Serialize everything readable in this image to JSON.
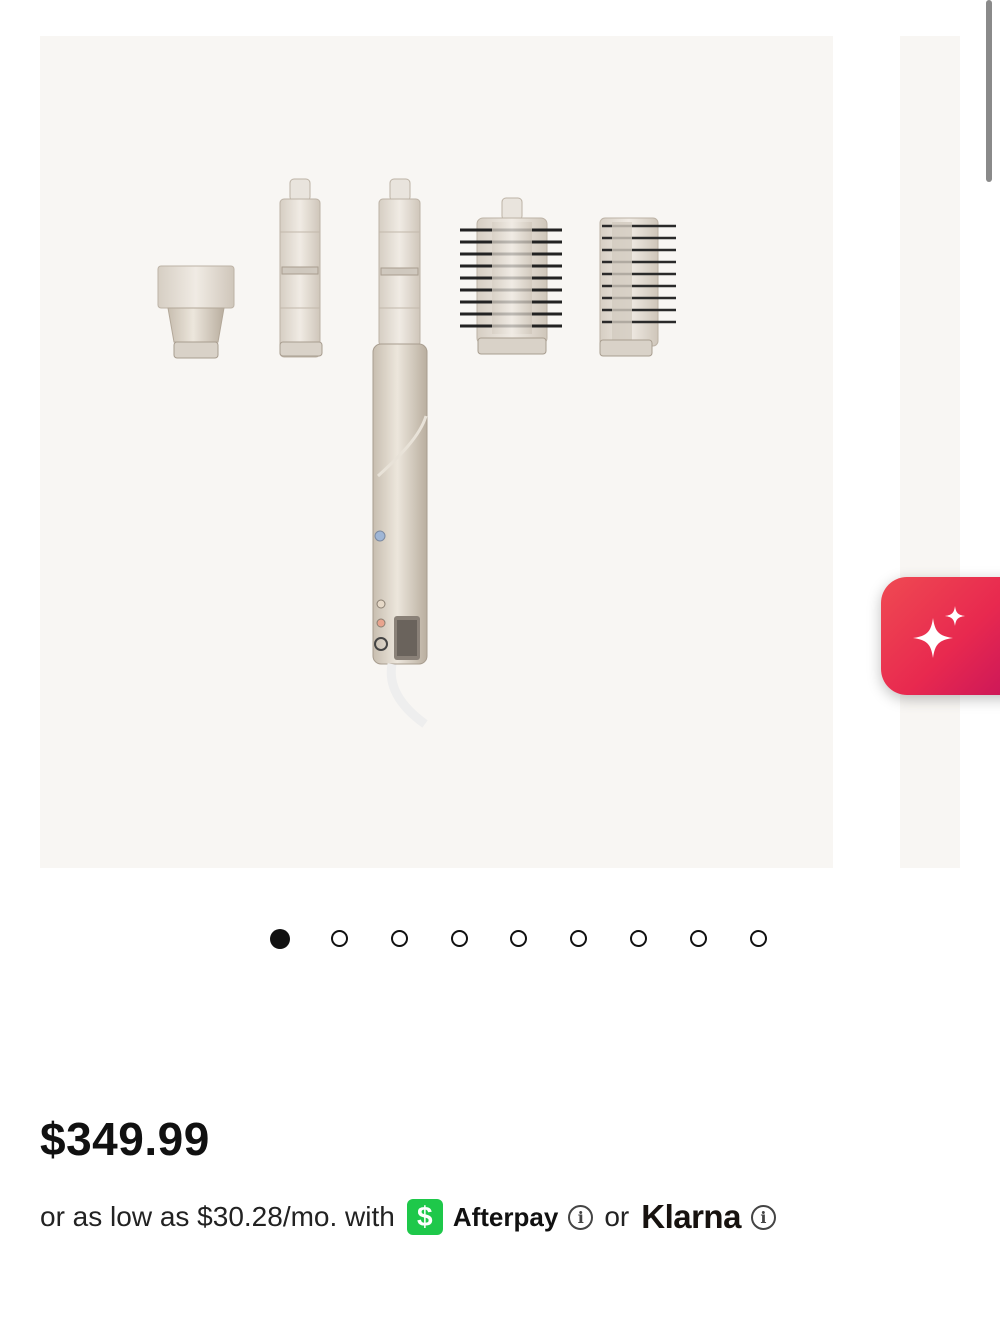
{
  "gallery": {
    "slide_count": 9,
    "active_index": 0,
    "image_alt": "Multi-styler with five attachments"
  },
  "product": {
    "price": "$349.99"
  },
  "financing": {
    "prefix": "or as low as $30.28/mo. with",
    "afterpay_badge": "$",
    "afterpay_label": "Afterpay",
    "or": "or",
    "klarna_label": "Klarna",
    "info_glyph": "i"
  },
  "icons": {
    "ai_button": "sparkle-icon",
    "info": "info-icon"
  },
  "colors": {
    "gallery_bg": "#f8f6f3",
    "afterpay_green": "#1ec84a",
    "fab_gradient_start": "#ef4a52",
    "fab_gradient_end": "#c8145a"
  }
}
